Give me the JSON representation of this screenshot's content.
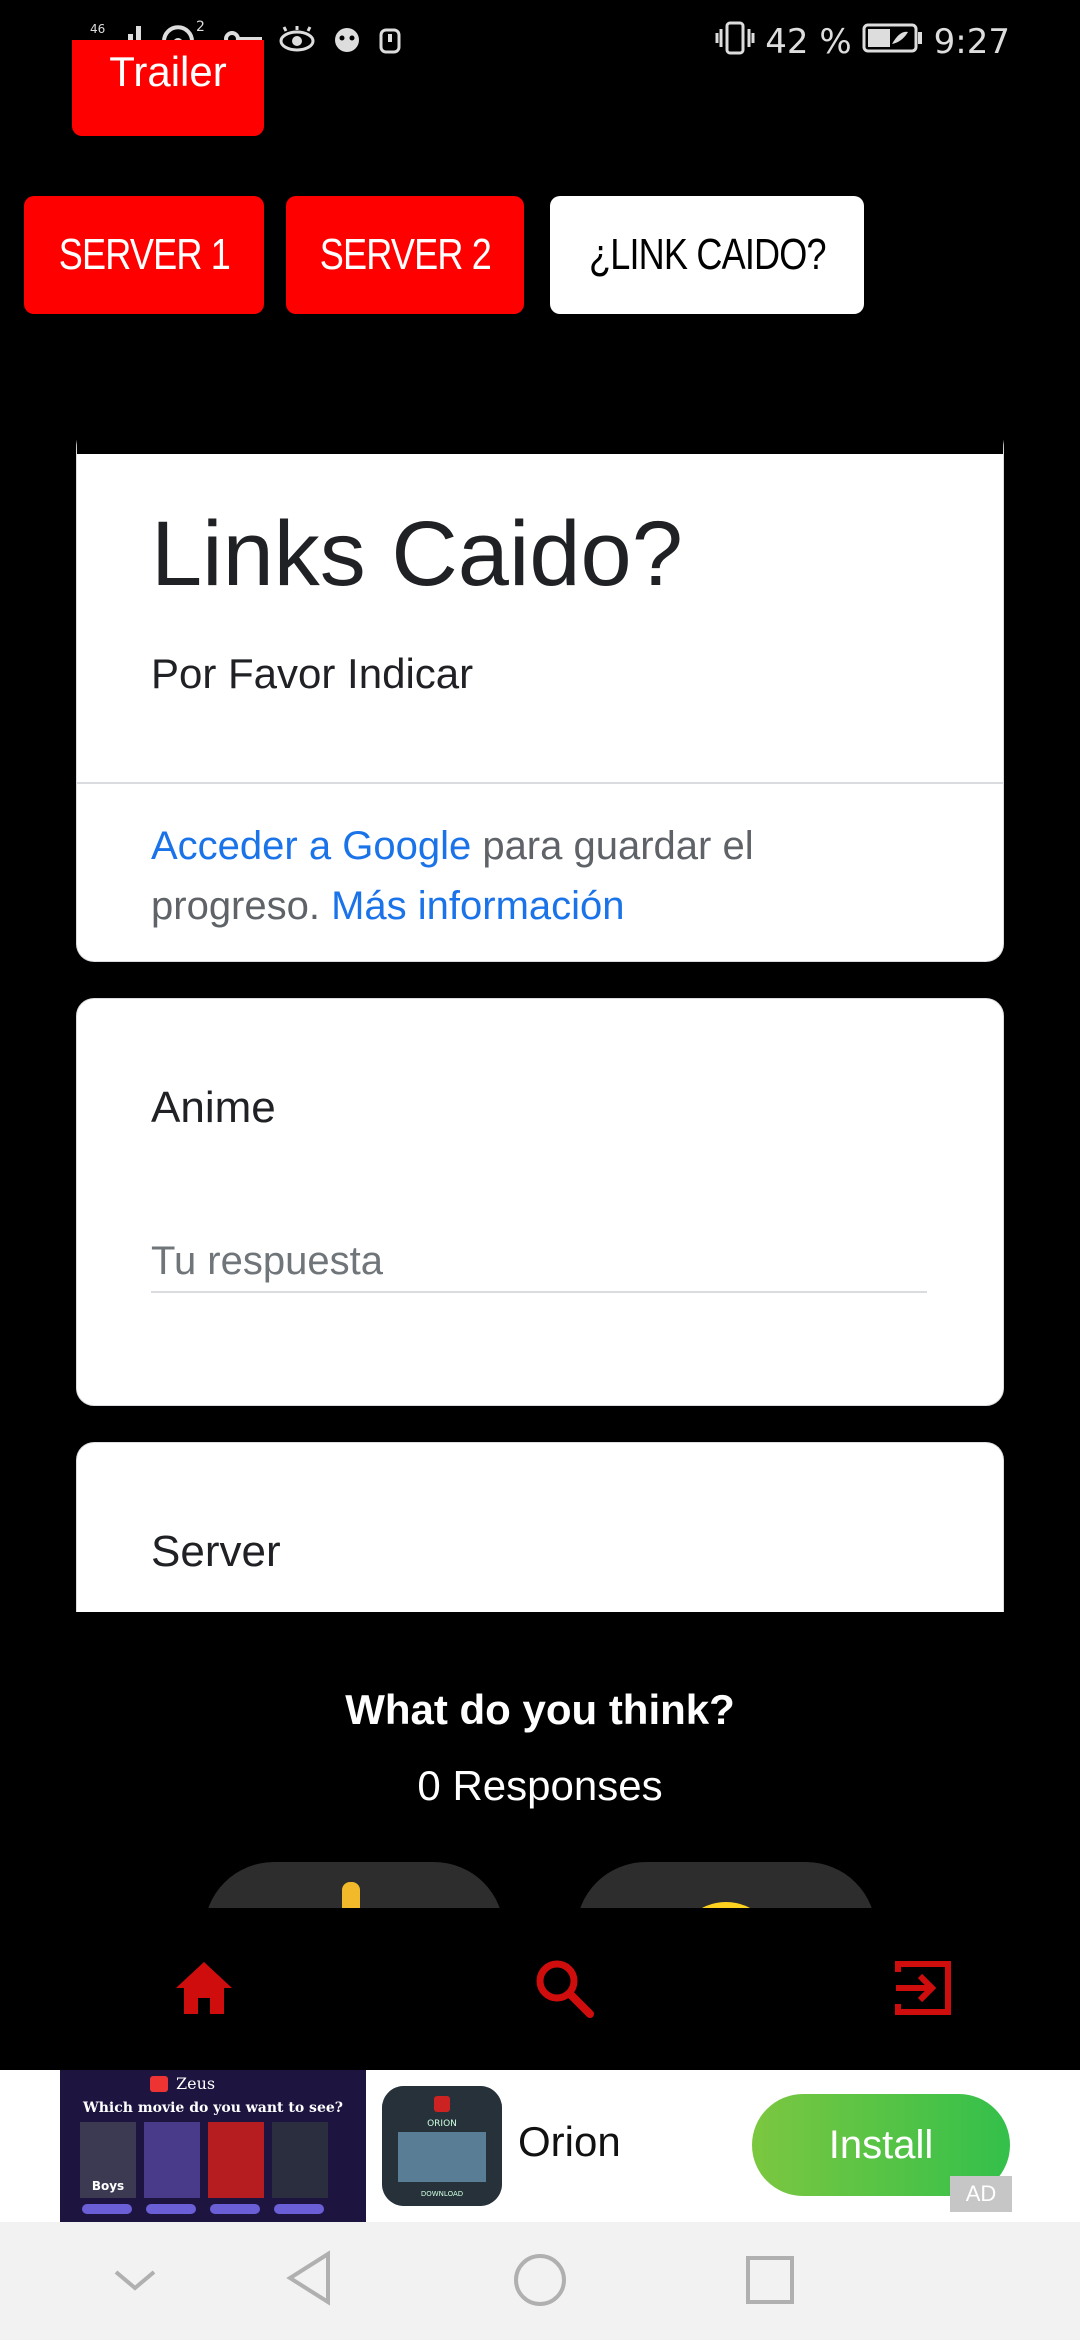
{
  "status_bar": {
    "signal": "46",
    "wifi_badge": "2",
    "battery": "42 %",
    "time": "9:27"
  },
  "top_buttons": {
    "trailer_label": "Trailer",
    "server1_label": "SERVER 1",
    "server2_label": "SERVER 2",
    "broken_link_label": "¿LINK CAIDO?"
  },
  "form": {
    "title": "Links Caido?",
    "description": "Por Favor Indicar",
    "signin_link": "Acceder a Google",
    "signin_text": " para guardar el progreso. ",
    "more_info_link": "Más información",
    "questions": [
      {
        "label": "Anime",
        "placeholder": "Tu respuesta"
      },
      {
        "label": "Server"
      }
    ]
  },
  "feedback": {
    "title": "What do you think?",
    "responses": "0 Responses"
  },
  "bottom_nav": {
    "items": [
      "home-icon",
      "search-icon",
      "logout-icon"
    ],
    "color": "#d00d0d"
  },
  "ad": {
    "app_name": "Orion",
    "install_label": "Install",
    "badge": "AD",
    "banner_brand": "Zeus",
    "banner_question": "Which movie do you want to see?",
    "banner_poster_text": "Boys",
    "app_icon_text": "ORION",
    "app_icon_sub": "DOWNLOAD"
  },
  "colors": {
    "accent_red": "#ff0000",
    "link_blue": "#1a73e8",
    "install_green": "#52c447"
  }
}
